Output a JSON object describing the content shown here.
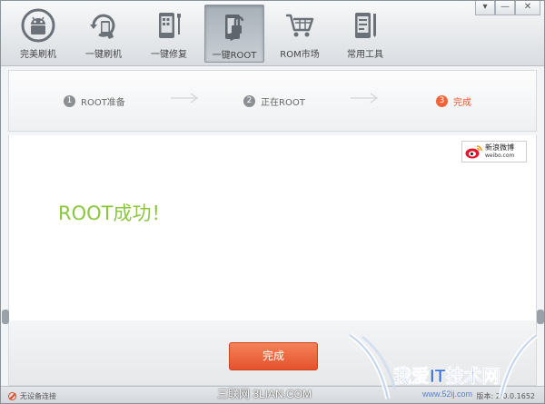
{
  "window": {
    "controls": {
      "settings": "▾",
      "minimize": "—",
      "close": "✕"
    }
  },
  "toolbar": {
    "items": [
      {
        "label": "完美刷机",
        "icon": "android-icon"
      },
      {
        "label": "一键刷机",
        "icon": "refresh-phone-icon"
      },
      {
        "label": "一键修复",
        "icon": "phone-repair-icon"
      },
      {
        "label": "一键ROOT",
        "icon": "unlock-phone-icon",
        "active": true
      },
      {
        "label": "ROM市场",
        "icon": "cart-icon"
      },
      {
        "label": "常用工具",
        "icon": "phone-tools-icon"
      }
    ]
  },
  "steps": [
    {
      "num": "1",
      "label": "ROOT准备"
    },
    {
      "num": "2",
      "label": "正在ROOT"
    },
    {
      "num": "3",
      "label": "完成",
      "current": true
    }
  ],
  "content": {
    "message": "ROOT成功！",
    "weibo": {
      "name": "新浪微博",
      "domain": "weibo.com"
    },
    "done_button": "完成"
  },
  "status": {
    "device": "无设备连接",
    "version": "版本: 2.0.0.1652"
  },
  "watermarks": {
    "left": "三联网 3LIAN.COM",
    "right_title": "我爱IT技术网",
    "right_url": "www.52ij.com"
  },
  "colors": {
    "accent_orange": "#e4522b",
    "success_green": "#8cc63f"
  }
}
